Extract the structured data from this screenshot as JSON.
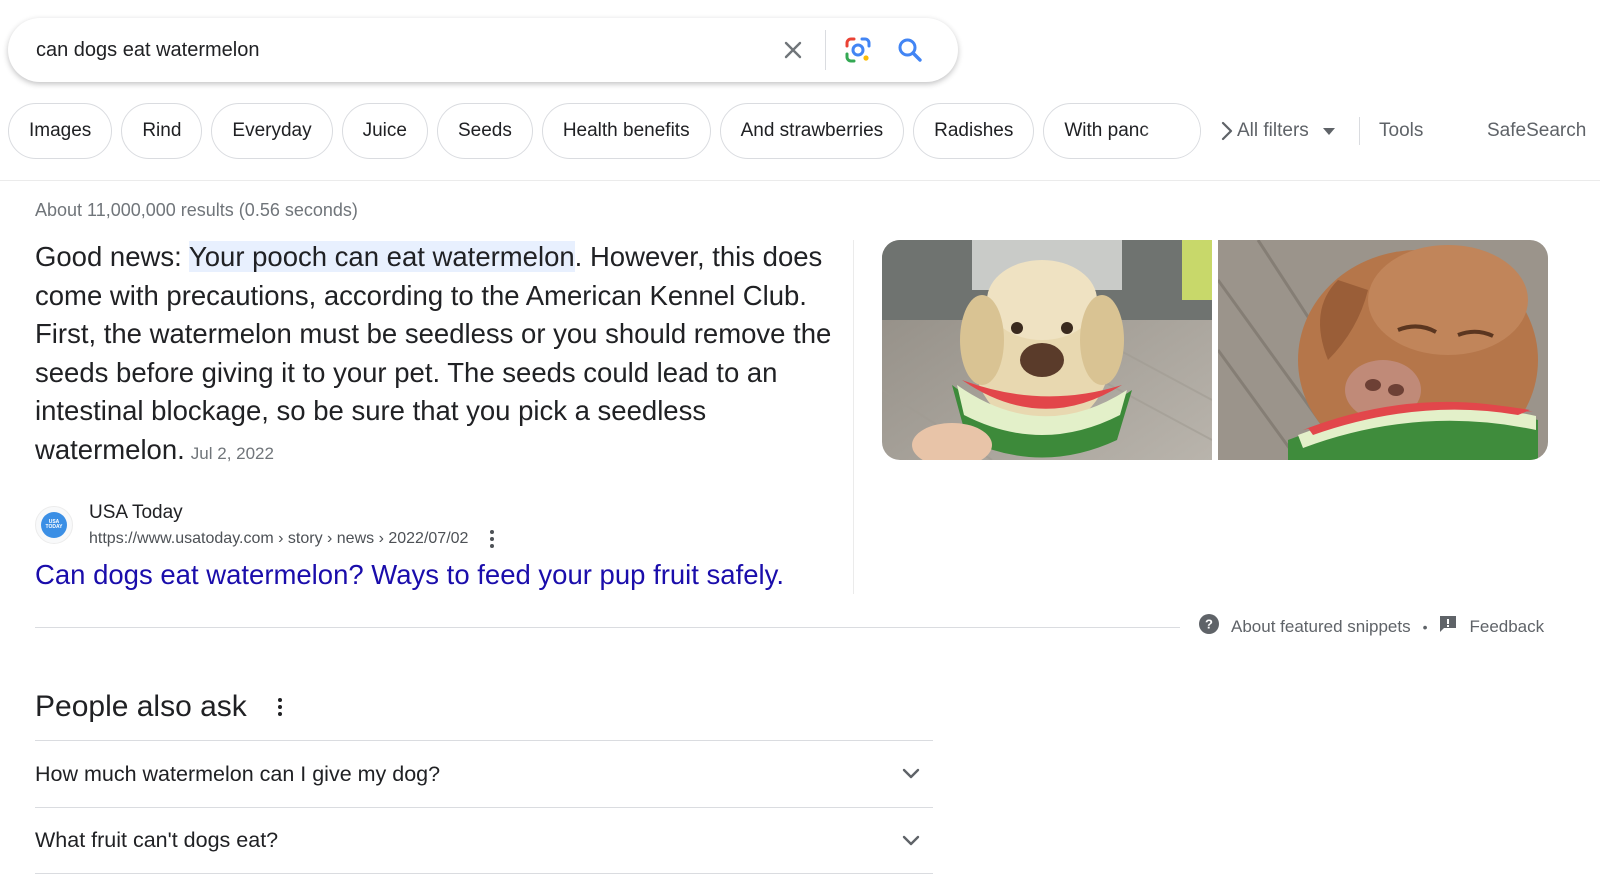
{
  "search": {
    "query": "can dogs eat watermelon",
    "icons": [
      "close-icon",
      "google-lens-icon",
      "search-icon"
    ]
  },
  "chips": [
    {
      "label": "Images"
    },
    {
      "label": "Rind"
    },
    {
      "label": "Everyday"
    },
    {
      "label": "Juice"
    },
    {
      "label": "Seeds"
    },
    {
      "label": "Health benefits"
    },
    {
      "label": "And strawberries"
    },
    {
      "label": "Radishes"
    },
    {
      "label": "With panc"
    }
  ],
  "toolbar": {
    "all_filters": "All filters",
    "tools": "Tools",
    "safesearch": "SafeSearch"
  },
  "results_count": "About 11,000,000 results (0.56 seconds)",
  "snippet": {
    "lead": "Good news: ",
    "highlight": "Your pooch can eat watermelon",
    "rest": ". However, this does come with precautions, according to the American Kennel Club. First, the watermelon must be seedless or you should remove the seeds before giving it to your pet. The seeds could lead to an intestinal blockage, so be sure that you pick a seedless watermelon.",
    "date": "Jul 2, 2022"
  },
  "source": {
    "name": "USA Today",
    "favicon_text": "USA TODAY",
    "url": "https://www.usatoday.com › story › news › 2022/07/02",
    "title": "Can dogs eat watermelon? Ways to feed your pup fruit safely."
  },
  "snippet_footer": {
    "about": "About featured snippets",
    "separator": "•",
    "feedback": "Feedback"
  },
  "people_also_ask": {
    "title": "People also ask",
    "questions": [
      "How much watermelon can I give my dog?",
      "What fruit can't dogs eat?"
    ]
  },
  "colors": {
    "link": "#1a0dab",
    "highlight": "#e8f0fe",
    "secondary_text": "#70757a",
    "border": "#dadce0"
  }
}
